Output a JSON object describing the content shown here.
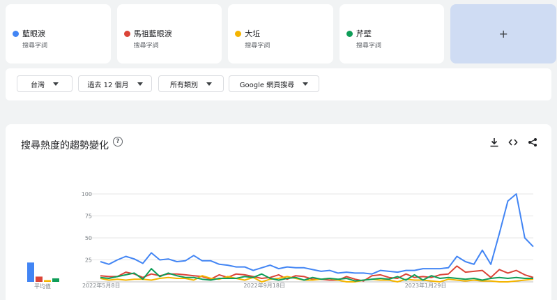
{
  "terms": [
    {
      "name": "藍眼淚",
      "sub": "搜尋字詞",
      "color": "#4285f4"
    },
    {
      "name": "馬祖藍眼淚",
      "sub": "搜尋字詞",
      "color": "#db4437"
    },
    {
      "name": "大坵",
      "sub": "搜尋字詞",
      "color": "#f4b400"
    },
    {
      "name": "芹壁",
      "sub": "搜尋字詞",
      "color": "#0f9d58"
    }
  ],
  "add_label": "+",
  "filters": {
    "region": "台灣",
    "period": "過去 12 個月",
    "category": "所有類別",
    "search_type": "Google 網頁搜尋"
  },
  "panel": {
    "title": "搜尋熱度的趨勢變化",
    "help": "?",
    "avg_label": "平均值"
  },
  "chart_data": {
    "type": "line",
    "ylim": [
      0,
      100
    ],
    "yticks": [
      25,
      50,
      75,
      100
    ],
    "xtick_labels": [
      {
        "label": "2022年5月8日",
        "index": 0
      },
      {
        "label": "2022年9月18日",
        "index": 19
      },
      {
        "label": "2023年1月29日",
        "index": 38
      }
    ],
    "averages": [
      {
        "name": "藍眼淚",
        "value": 22
      },
      {
        "name": "馬祖藍眼淚",
        "value": 6
      },
      {
        "name": "大坵",
        "value": 2
      },
      {
        "name": "芹壁",
        "value": 4
      }
    ],
    "series": [
      {
        "name": "藍眼淚",
        "color": "#4285f4",
        "values": [
          23,
          20,
          25,
          29,
          26,
          21,
          33,
          25,
          26,
          23,
          24,
          30,
          24,
          24,
          20,
          19,
          17,
          17,
          13,
          16,
          19,
          15,
          17,
          16,
          16,
          14,
          12,
          13,
          10,
          11,
          10,
          10,
          9,
          13,
          12,
          11,
          13,
          13,
          15,
          15,
          15,
          16,
          29,
          23,
          20,
          36,
          20,
          55,
          92,
          100,
          50,
          40
        ]
      },
      {
        "name": "馬祖藍眼淚",
        "color": "#db4437",
        "values": [
          7,
          6,
          6,
          11,
          9,
          5,
          9,
          7,
          9,
          9,
          8,
          7,
          6,
          3,
          8,
          5,
          9,
          8,
          6,
          4,
          5,
          8,
          3,
          7,
          6,
          3,
          3,
          2,
          2,
          6,
          3,
          1,
          7,
          8,
          5,
          4,
          9,
          5,
          6,
          5,
          8,
          9,
          18,
          11,
          12,
          13,
          5,
          14,
          10,
          13,
          8,
          5
        ]
      },
      {
        "name": "大坵",
        "color": "#f4b400",
        "values": [
          4,
          2,
          3,
          2,
          3,
          3,
          2,
          4,
          5,
          4,
          4,
          2,
          7,
          4,
          3,
          6,
          4,
          2,
          5,
          0,
          3,
          4,
          6,
          4,
          2,
          2,
          3,
          4,
          2,
          0,
          0,
          2,
          3,
          2,
          2,
          0,
          3,
          2,
          2,
          1,
          0,
          3,
          2,
          1,
          2,
          1,
          1,
          0,
          0,
          1,
          2,
          3
        ]
      },
      {
        "name": "芹壁",
        "color": "#0f9d58",
        "values": [
          5,
          4,
          6,
          8,
          10,
          3,
          15,
          6,
          10,
          7,
          5,
          5,
          3,
          2,
          4,
          4,
          4,
          6,
          5,
          9,
          4,
          2,
          4,
          5,
          2,
          5,
          3,
          4,
          3,
          4,
          1,
          2,
          3,
          4,
          3,
          6,
          2,
          8,
          2,
          7,
          4,
          5,
          4,
          3,
          4,
          2,
          4,
          5,
          4,
          5,
          4,
          4
        ]
      }
    ]
  }
}
